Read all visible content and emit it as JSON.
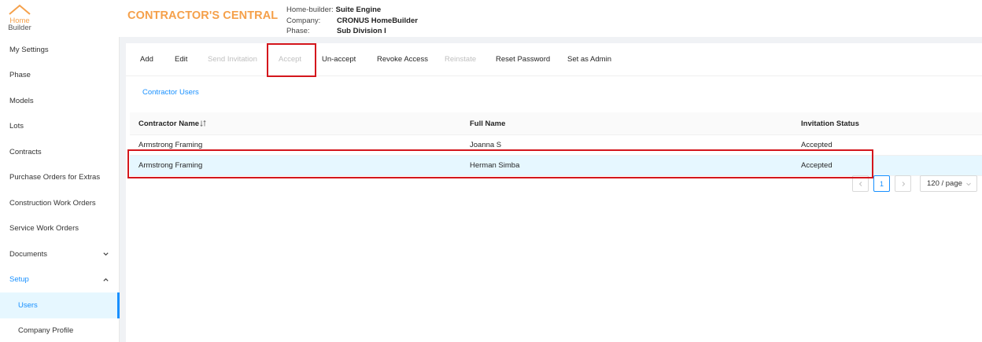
{
  "header": {
    "logo_line1": "Home",
    "logo_line2": "Builder",
    "title": "CONTRACTOR'S CENTRAL",
    "context": {
      "homebuilder_label": "Home-builder:",
      "homebuilder_value": "Suite Engine",
      "company_label": "Company:",
      "company_value": "CRONUS HomeBuilder",
      "phase_label": "Phase:",
      "phase_value": "Sub Division I"
    }
  },
  "sidebar": {
    "items": [
      {
        "label": "My Settings"
      },
      {
        "label": "Phase"
      },
      {
        "label": "Models"
      },
      {
        "label": "Lots"
      },
      {
        "label": "Contracts"
      },
      {
        "label": "Purchase Orders for Extras"
      },
      {
        "label": "Construction Work Orders"
      },
      {
        "label": "Service Work Orders"
      },
      {
        "label": "Documents",
        "icon": "chevron-down-icon"
      },
      {
        "label": "Setup",
        "icon": "chevron-up-icon"
      },
      {
        "label": "Users"
      },
      {
        "label": "Company Profile"
      }
    ]
  },
  "toolbar": {
    "add": "Add",
    "edit": "Edit",
    "send_invitation": "Send Invitation",
    "accept": "Accept",
    "unaccept": "Un-accept",
    "revoke_access": "Revoke Access",
    "reinstate": "Reinstate",
    "reset_password": "Reset Password",
    "set_as_admin": "Set as Admin"
  },
  "tabs": {
    "contractor_users": "Contractor Users"
  },
  "table": {
    "columns": [
      "Contractor Name",
      "Full Name",
      "Invitation Status"
    ],
    "rows": [
      [
        "Armstrong Framing",
        "Joanna S",
        "Accepted"
      ],
      [
        "Armstrong Framing",
        "Herman Simba",
        "Accepted"
      ]
    ],
    "selected_row": 1
  },
  "pagination": {
    "current_page": "1",
    "page_size": "120 / page"
  },
  "colors": {
    "brand_orange": "#f5a04a",
    "accent_blue": "#1890ff",
    "highlight_red": "#d4161c"
  }
}
